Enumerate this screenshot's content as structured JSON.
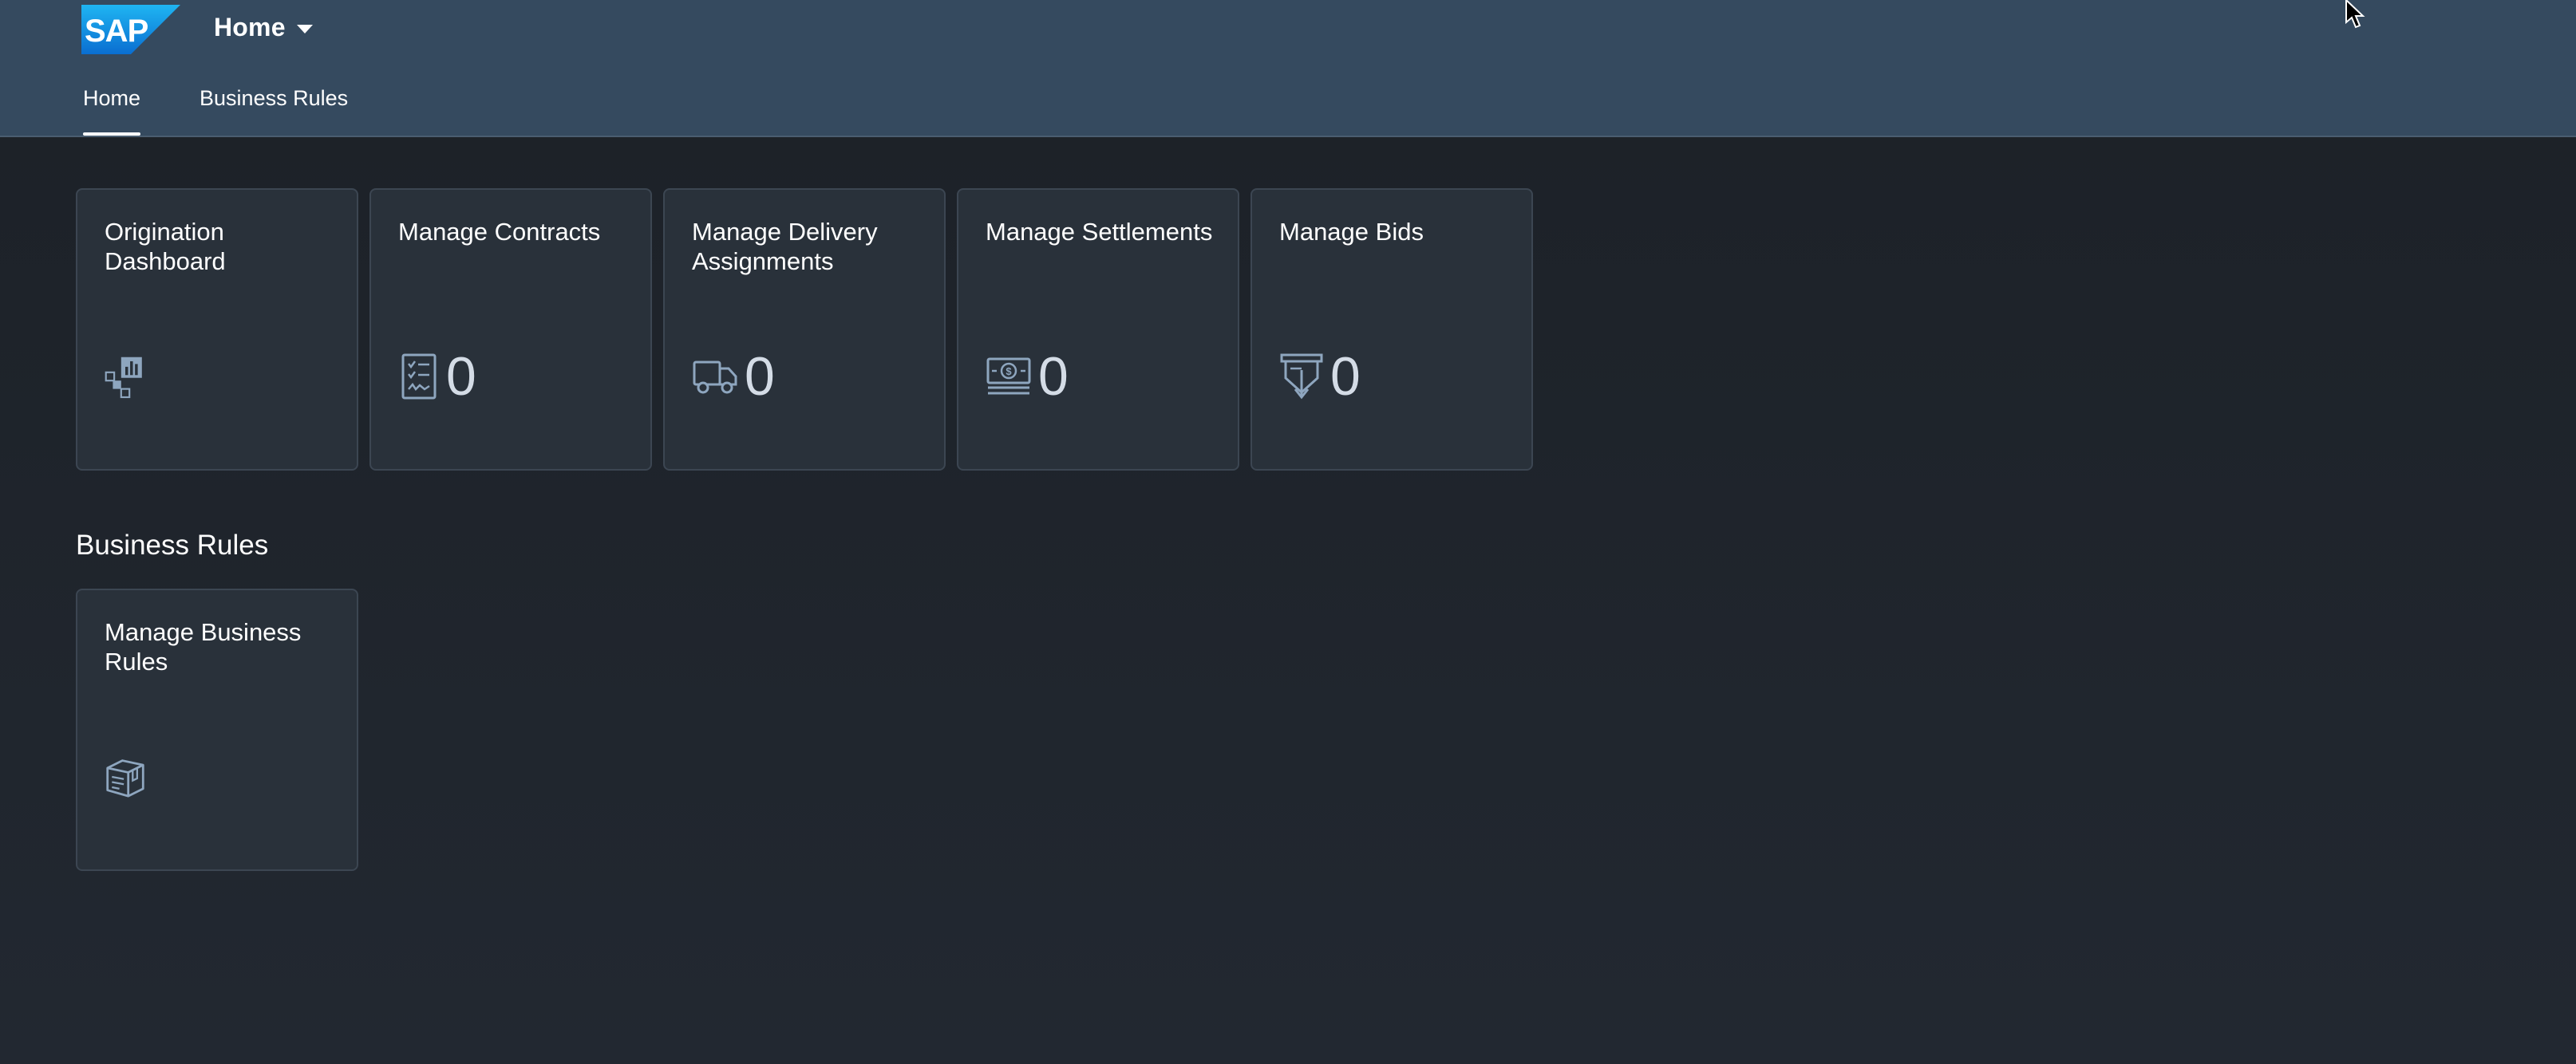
{
  "header": {
    "logo_text": "SAP",
    "app_title": "Home",
    "brand_color": "#0a6ed1",
    "background_color": "#354a5f"
  },
  "tabs": [
    {
      "label": "Home",
      "active": true
    },
    {
      "label": "Business Rules",
      "active": false
    }
  ],
  "tiles": [
    {
      "title": "Origination Dashboard",
      "icon": "dashboard-icon",
      "count": null
    },
    {
      "title": "Manage Contracts",
      "icon": "checklist-document-icon",
      "count": "0"
    },
    {
      "title": "Manage Delivery Assignments",
      "icon": "truck-icon",
      "count": "0"
    },
    {
      "title": "Manage Settlements",
      "icon": "money-bills-icon",
      "count": "0"
    },
    {
      "title": "Manage Bids",
      "icon": "bid-download-icon",
      "count": "0"
    }
  ],
  "business_rules_section": {
    "title": "Business Rules",
    "tiles": [
      {
        "title": "Manage Business Rules",
        "icon": "rules-box-icon",
        "count": null
      }
    ]
  }
}
